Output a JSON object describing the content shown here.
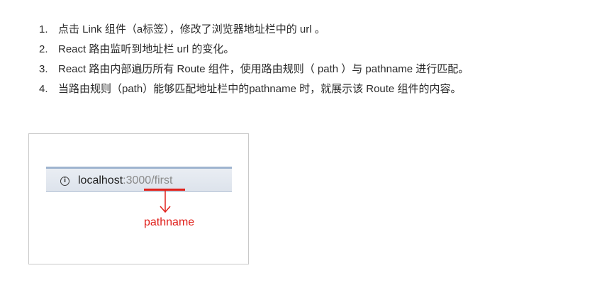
{
  "steps": [
    {
      "num": "1.",
      "text": "点击 Link 组件（a标签），修改了浏览器地址栏中的 url 。"
    },
    {
      "num": "2.",
      "text": "React 路由监听到地址栏 url 的变化。"
    },
    {
      "num": "3.",
      "text": "React 路由内部遍历所有 Route 组件，使用路由规则（ path ）与 pathname 进行匹配。"
    },
    {
      "num": "4.",
      "text": "当路由规则（path）能够匹配地址栏中的pathname 时，就展示该 Route 组件的内容。"
    }
  ],
  "figure": {
    "info_icon_glyph": "i",
    "url_host": "localhost",
    "url_port": ":3000",
    "url_path": "/first",
    "annotation_label": "pathname",
    "annotation_color": "#e0201b"
  }
}
